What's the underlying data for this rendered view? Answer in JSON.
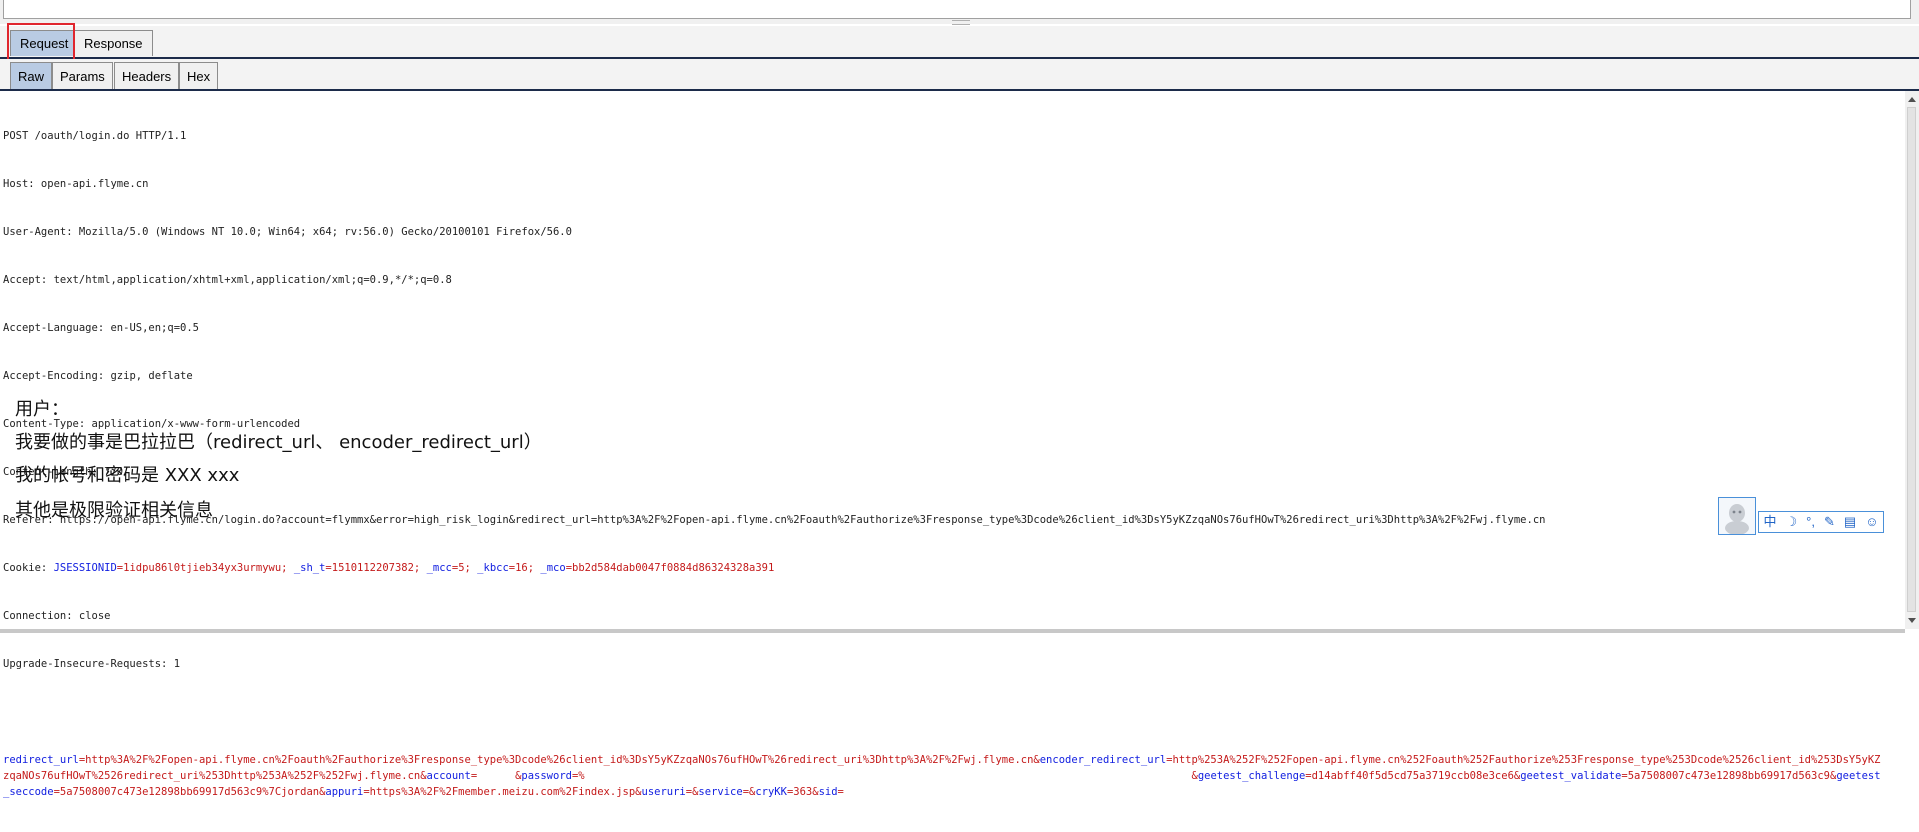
{
  "tabs": [
    "Request",
    "Response"
  ],
  "subtabs": [
    "Raw",
    "Params",
    "Headers",
    "Hex"
  ],
  "request": {
    "request_line": "POST /oauth/login.do HTTP/1.1",
    "host": {
      "name": "Host:",
      "value": " open-api.flyme.cn"
    },
    "user_agent": {
      "name": "User-Agent:",
      "value": " Mozilla/5.0 (Windows NT 10.0; Win64; x64; rv:56.0) Gecko/20100101 Firefox/56.0"
    },
    "accept": {
      "name": "Accept:",
      "value": " text/html,application/xhtml+xml,application/xml;q=0.9,*/*;q=0.8"
    },
    "accept_language": {
      "name": "Accept-Language:",
      "value": " en-US,en;q=0.5"
    },
    "accept_encoding": {
      "name": "Accept-Encoding:",
      "value": " gzip, deflate"
    },
    "content_type": {
      "name": "Content-Type:",
      "value": " application/x-www-form-urlencoded"
    },
    "content_length": {
      "name": "Content-Length:",
      "value": " 770"
    },
    "referer": {
      "name": "Referer:",
      "value": " https://open-api.flyme.cn/login.do?account=flymmx&error=high_risk_login&redirect_url=http%3A%2F%2Fopen-api.flyme.cn%2Foauth%2Fauthorize%3Fresponse_type%3Dcode%26client_id%3DsY5yKZzqaNOs76ufHOwT%26redirect_uri%3Dhttp%3A%2F%2Fwj.flyme.cn"
    },
    "cookie": {
      "name": "Cookie: ",
      "c1_name": "JSESSIONID",
      "c1_value": "=1idpu86l0tjieb34yx3urmywu; ",
      "c2_name": "_sh_t",
      "c2_value": "=1510112207382; ",
      "c3_name": "_mcc",
      "c3_value": "=5; ",
      "c4_name": "_kbcc",
      "c4_value": "=16; ",
      "c5_name": "_mco",
      "c5_value": "=bb2d584dab0047f0884d86324328a391"
    },
    "connection": {
      "name": "Connection:",
      "value": " close"
    },
    "upgrade": {
      "name": "Upgrade-Insecure-Requests:",
      "value": " 1"
    },
    "body": {
      "p1_name": "redirect_url",
      "p1_value": "=http%3A%2F%2Fopen-api.flyme.cn%2Foauth%2Fauthorize%3Fresponse_type%3Dcode%26client_id%3DsY5yKZzqaNOs76ufHOwT%26redirect_uri%3Dhttp%3A%2F%2Fwj.flyme.cn&",
      "p2_name": "encoder_redirect_url",
      "p2_value": "=http%253A%252F%252Fopen-api.flyme.cn%252Foauth%252Fauthorize%253Fresponse_type%253Dcode%2526client_id%253DsY5yKZzqaNOs76ufHOwT%2526redirect_uri%253Dhttp%253A%252F%252Fwj.flyme.cn&",
      "p3_name": "account",
      "p3_value": "=      &",
      "p4_name": "password",
      "p4_value": "=%                                                                                                &",
      "p5_name": "geetest_challenge",
      "p5_value": "=d14abff40f5d5cd75a3719ccb08e3ce6&",
      "p6_name": "geetest_validate",
      "p6_value": "=5a7508007c473e12898bb69917d563c9&",
      "p7_name": "geetest_seccode",
      "p7_value": "=5a7508007c473e12898bb69917d563c9%7Cjordan&",
      "p8_name": "appuri",
      "p8_value": "=https%3A%2F%2Fmember.meizu.com%2Findex.jsp&",
      "p9_name": "useruri",
      "p9_value": "=&",
      "p10_name": "service",
      "p10_value": "=&",
      "p11_name": "cryKK",
      "p11_value": "=363&",
      "p12_name": "sid",
      "p12_value": "="
    }
  },
  "notes": {
    "line1": "用户：",
    "line2": "我要做的事是巴拉拉巴（redirect_url、 encoder_redirect_url）",
    "line3": "我的帐号和密码是 XXX xxx",
    "line4": "其他是极限验证相关信息"
  },
  "ime": {
    "items": [
      "中",
      "☽",
      "°,",
      "✎",
      "▤",
      "☺"
    ]
  }
}
